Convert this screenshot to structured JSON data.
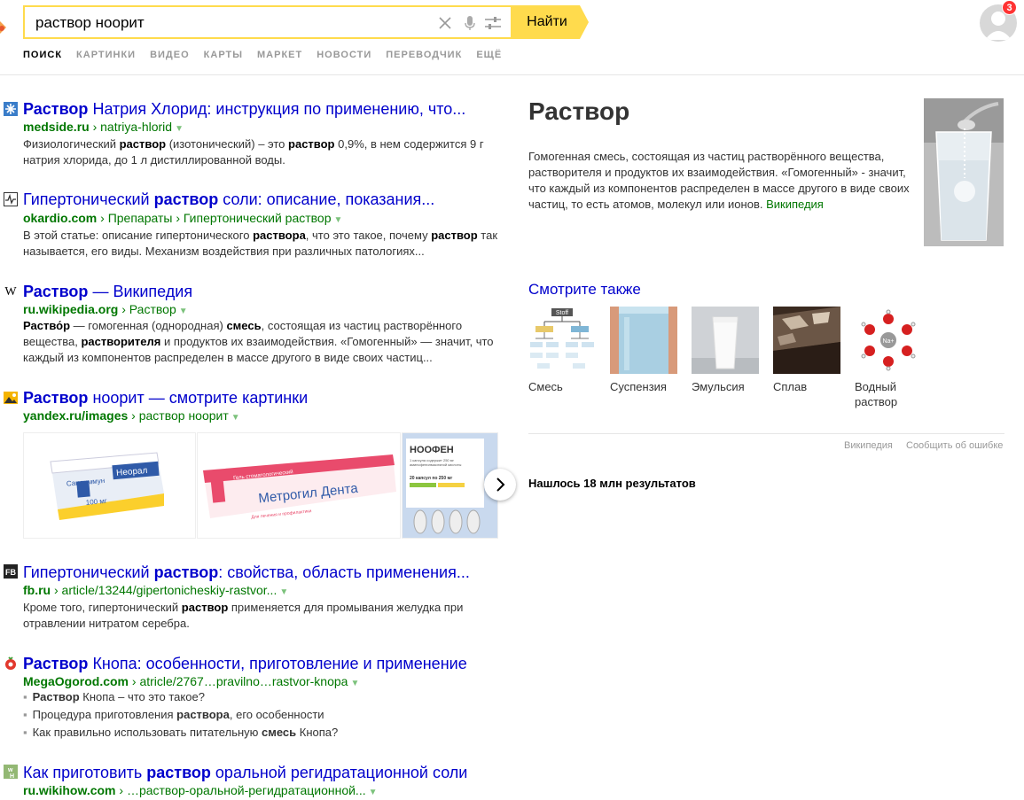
{
  "search": {
    "query": "раствор ноорит",
    "button_label": "Найти"
  },
  "user": {
    "notifications": "3"
  },
  "tabs": [
    "ПОИСК",
    "КАРТИНКИ",
    "ВИДЕО",
    "КАРТЫ",
    "МАРКЕТ",
    "НОВОСТИ",
    "ПЕРЕВОДЧИК",
    "ЕЩЁ"
  ],
  "results": [
    {
      "title_bold": "Раствор",
      "title_rest": " Натрия Хлорид: инструкция по применению, что...",
      "domain": "medside.ru",
      "path": " › natriya-hlorid",
      "snippet": [
        {
          "t": "Физиологический ",
          "b": false
        },
        {
          "t": "раствор",
          "b": true
        },
        {
          "t": " (изотонический) – это ",
          "b": false
        },
        {
          "t": "раствор",
          "b": true
        },
        {
          "t": " 0,9%, в нем содержится 9 г натрия хлорида, до 1 л дистиллированной воды.",
          "b": false
        }
      ]
    },
    {
      "title_pre": "Гипертонический ",
      "title_bold": "раствор",
      "title_rest": " соли: описание, показания...",
      "domain": "okardio.com",
      "path": " › Препараты › Гипертонический раствор",
      "snippet": [
        {
          "t": "В этой статье: описание гипертонического ",
          "b": false
        },
        {
          "t": "раствора",
          "b": true
        },
        {
          "t": ", что это такое, почему ",
          "b": false
        },
        {
          "t": "раствор",
          "b": true
        },
        {
          "t": " так называется, его виды. Механизм воздействия при различных патологиях...",
          "b": false
        }
      ]
    },
    {
      "title_bold": "Раствор",
      "title_rest": " — Википедия",
      "domain": "ru.wikipedia.org",
      "path": " › Раствор",
      "snippet": [
        {
          "t": "Раство́р",
          "b": true
        },
        {
          "t": " — гомогенная (однородная) ",
          "b": false
        },
        {
          "t": "смесь",
          "b": true
        },
        {
          "t": ", состоящая из частиц растворённого вещества, ",
          "b": false
        },
        {
          "t": "растворителя",
          "b": true
        },
        {
          "t": " и продуктов их взаимодействия. «Гомогенный» — значит, что каждый из компонентов распределен в массе другого в виде своих частиц...",
          "b": false
        }
      ]
    },
    {
      "title_bold": "Раствор",
      "title_rest": " ноорит — смотрите картинки",
      "domain": "yandex.ru/images",
      "path": " › раствор ноорит"
    },
    {
      "title_pre": "Гипертонический ",
      "title_bold": "раствор",
      "title_rest": ": свойства, область применения...",
      "domain": "fb.ru",
      "path": " › article/13244/gipertonicheskiy-rastvor...",
      "snippet": [
        {
          "t": "Кроме того, гипертонический ",
          "b": false
        },
        {
          "t": "раствор",
          "b": true
        },
        {
          "t": " применяется для промывания желудка при отравлении нитратом серебра.",
          "b": false
        }
      ]
    },
    {
      "title_bold": "Раствор",
      "title_rest": " Кнопа: особенности, приготовление и применение",
      "domain": "MegaOgorod.com",
      "path": " › atricle/2767…pravilno…rastvor-knopa",
      "bullets": [
        [
          {
            "t": "Раствор",
            "b": true
          },
          {
            "t": " Кнопа – что это такое?",
            "b": false
          }
        ],
        [
          {
            "t": "Процедура приготовления ",
            "b": false
          },
          {
            "t": "раствора",
            "b": true
          },
          {
            "t": ", его особенности",
            "b": false
          }
        ],
        [
          {
            "t": "Как правильно использовать питательную ",
            "b": false
          },
          {
            "t": "смесь",
            "b": true
          },
          {
            "t": " Кнопа?",
            "b": false
          }
        ]
      ]
    },
    {
      "title_pre": "Как приготовить ",
      "title_bold": "раствор",
      "title_rest": " оральной регидратационной соли",
      "domain": "ru.wikihow.com",
      "path": " › …раствор-оральной-регидратационной..."
    }
  ],
  "images": {
    "neoral": {
      "brand": "Сандиммун",
      "name": "Неорал",
      "dose": "100 мг"
    },
    "metrogil": {
      "top": "Гель стоматологический",
      "name": "Метрогил Дента",
      "sub": "Для лечения и профилактики воспалительных заболеваний полости рта"
    },
    "noofen": {
      "name": "НООФЕН",
      "sub": "1 капсула содержит 250 мг аминофенилмасляной кислоты гидрохлорида",
      "count": "20 капсул по 250 мг"
    }
  },
  "knowledge": {
    "title": "Раствор",
    "description": "Гомогенная смесь, состоящая из частиц растворённого вещества, растворителя и продуктов их взаимодействия. «Гомогенный» - значит, что каждый из компонентов распределен в массе другого в виде своих частиц, то есть атомов, молекул или ионов.",
    "source": "Википедия",
    "see_also_title": "Смотрите также",
    "see_also": [
      "Смесь",
      "Суспензия",
      "Эмульсия",
      "Сплав",
      "Водный раствор"
    ],
    "diagram_label": "Stoff",
    "ion_label": "Na+",
    "footer_source": "Википедия",
    "footer_report": "Сообщить об ошибке",
    "found": "Нашлось 18 млн результатов"
  },
  "colors": {
    "accent": "#ffdb4d",
    "link": "#0000cc",
    "url": "#007700"
  }
}
